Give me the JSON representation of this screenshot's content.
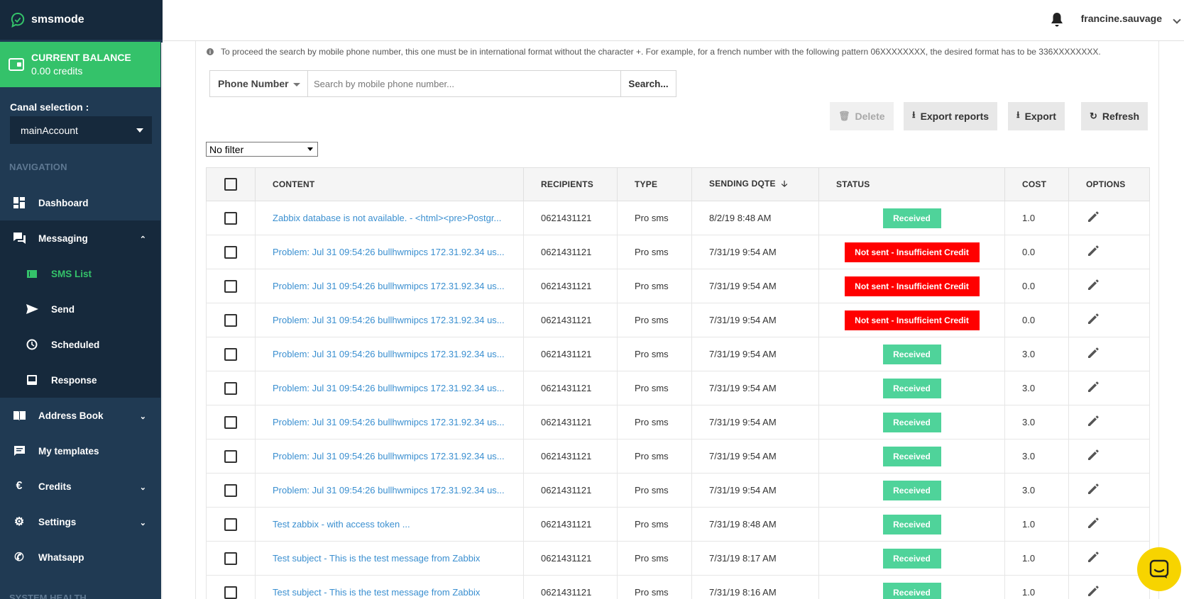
{
  "brand": "smsmode",
  "balance": {
    "title": "CURRENT BALANCE",
    "value": "0.00 credits"
  },
  "canal": {
    "label": "Canal selection :",
    "selected": "mainAccount"
  },
  "nav": {
    "heading": "NAVIGATION",
    "items": [
      {
        "label": "Dashboard",
        "icon": "dashboard-icon"
      },
      {
        "label": "Messaging",
        "icon": "messaging-icon"
      },
      {
        "label": "SMS List",
        "icon": "list-icon"
      },
      {
        "label": "Send",
        "icon": "send-icon"
      },
      {
        "label": "Scheduled",
        "icon": "clock-icon"
      },
      {
        "label": "Response",
        "icon": "inbox-icon"
      },
      {
        "label": "Address Book",
        "icon": "book-icon"
      },
      {
        "label": "My templates",
        "icon": "template-icon"
      },
      {
        "label": "Credits",
        "icon": "euro-icon"
      },
      {
        "label": "Settings",
        "icon": "gear-icon"
      },
      {
        "label": "Whatsapp",
        "icon": "phone-icon"
      }
    ],
    "footer": "SYSTEM HEALTH"
  },
  "topbar": {
    "user": "francine.sauvage"
  },
  "info": "To proceed the search by mobile phone number, this one must be in international format without the character +. For example, for a french number with the following pattern 06XXXXXXXX, the desired format has to be 336XXXXXXXX.",
  "search": {
    "type": "Phone Number",
    "placeholder": "Search by mobile phone number...",
    "button": "Search..."
  },
  "actions": {
    "delete": "Delete",
    "export_reports": "Export reports",
    "export": "Export",
    "refresh": "Refresh"
  },
  "filter": "No filter",
  "table": {
    "headers": {
      "content": "CONTENT",
      "recipients": "RECIPIENTS",
      "type": "TYPE",
      "date": "SENDING DQTE",
      "status": "STATUS",
      "cost": "COST",
      "options": "OPTIONS"
    },
    "rows": [
      {
        "content": "Zabbix database is not available. - <html><pre>Postgr...",
        "recipient": "0621431121",
        "type": "Pro sms",
        "date": "8/2/19 8:48 AM",
        "status": "Received",
        "ok": true,
        "cost": "1.0"
      },
      {
        "content": "Problem: Jul 31 09:54:26 bullhwmipcs 172.31.92.34 us...",
        "recipient": "0621431121",
        "type": "Pro sms",
        "date": "7/31/19 9:54 AM",
        "status": "Not sent - Insufficient Credit",
        "ok": false,
        "cost": "0.0"
      },
      {
        "content": "Problem: Jul 31 09:54:26 bullhwmipcs 172.31.92.34 us...",
        "recipient": "0621431121",
        "type": "Pro sms",
        "date": "7/31/19 9:54 AM",
        "status": "Not sent - Insufficient Credit",
        "ok": false,
        "cost": "0.0"
      },
      {
        "content": "Problem: Jul 31 09:54:26 bullhwmipcs 172.31.92.34 us...",
        "recipient": "0621431121",
        "type": "Pro sms",
        "date": "7/31/19 9:54 AM",
        "status": "Not sent - Insufficient Credit",
        "ok": false,
        "cost": "0.0"
      },
      {
        "content": "Problem: Jul 31 09:54:26 bullhwmipcs 172.31.92.34 us...",
        "recipient": "0621431121",
        "type": "Pro sms",
        "date": "7/31/19 9:54 AM",
        "status": "Received",
        "ok": true,
        "cost": "3.0"
      },
      {
        "content": "Problem: Jul 31 09:54:26 bullhwmipcs 172.31.92.34 us...",
        "recipient": "0621431121",
        "type": "Pro sms",
        "date": "7/31/19 9:54 AM",
        "status": "Received",
        "ok": true,
        "cost": "3.0"
      },
      {
        "content": "Problem: Jul 31 09:54:26 bullhwmipcs 172.31.92.34 us...",
        "recipient": "0621431121",
        "type": "Pro sms",
        "date": "7/31/19 9:54 AM",
        "status": "Received",
        "ok": true,
        "cost": "3.0"
      },
      {
        "content": "Problem: Jul 31 09:54:26 bullhwmipcs 172.31.92.34 us...",
        "recipient": "0621431121",
        "type": "Pro sms",
        "date": "7/31/19 9:54 AM",
        "status": "Received",
        "ok": true,
        "cost": "3.0"
      },
      {
        "content": "Problem: Jul 31 09:54:26 bullhwmipcs 172.31.92.34 us...",
        "recipient": "0621431121",
        "type": "Pro sms",
        "date": "7/31/19 9:54 AM",
        "status": "Received",
        "ok": true,
        "cost": "3.0"
      },
      {
        "content": "Test zabbix - with access token ...",
        "recipient": "0621431121",
        "type": "Pro sms",
        "date": "7/31/19 8:48 AM",
        "status": "Received",
        "ok": true,
        "cost": "1.0"
      },
      {
        "content": "Test subject - This is the test message from Zabbix",
        "recipient": "0621431121",
        "type": "Pro sms",
        "date": "7/31/19 8:17 AM",
        "status": "Received",
        "ok": true,
        "cost": "1.0"
      },
      {
        "content": "Test subject - This is the test message from Zabbix",
        "recipient": "0621431121",
        "type": "Pro sms",
        "date": "7/31/19 8:16 AM",
        "status": "Received",
        "ok": true,
        "cost": "1.0"
      }
    ]
  },
  "colors": {
    "sidebar": "#203a53",
    "accent": "#34c26a",
    "received": "#4fd39a",
    "error": "#ff0000",
    "link": "#3a8fd0",
    "chat": "#f7d400"
  }
}
